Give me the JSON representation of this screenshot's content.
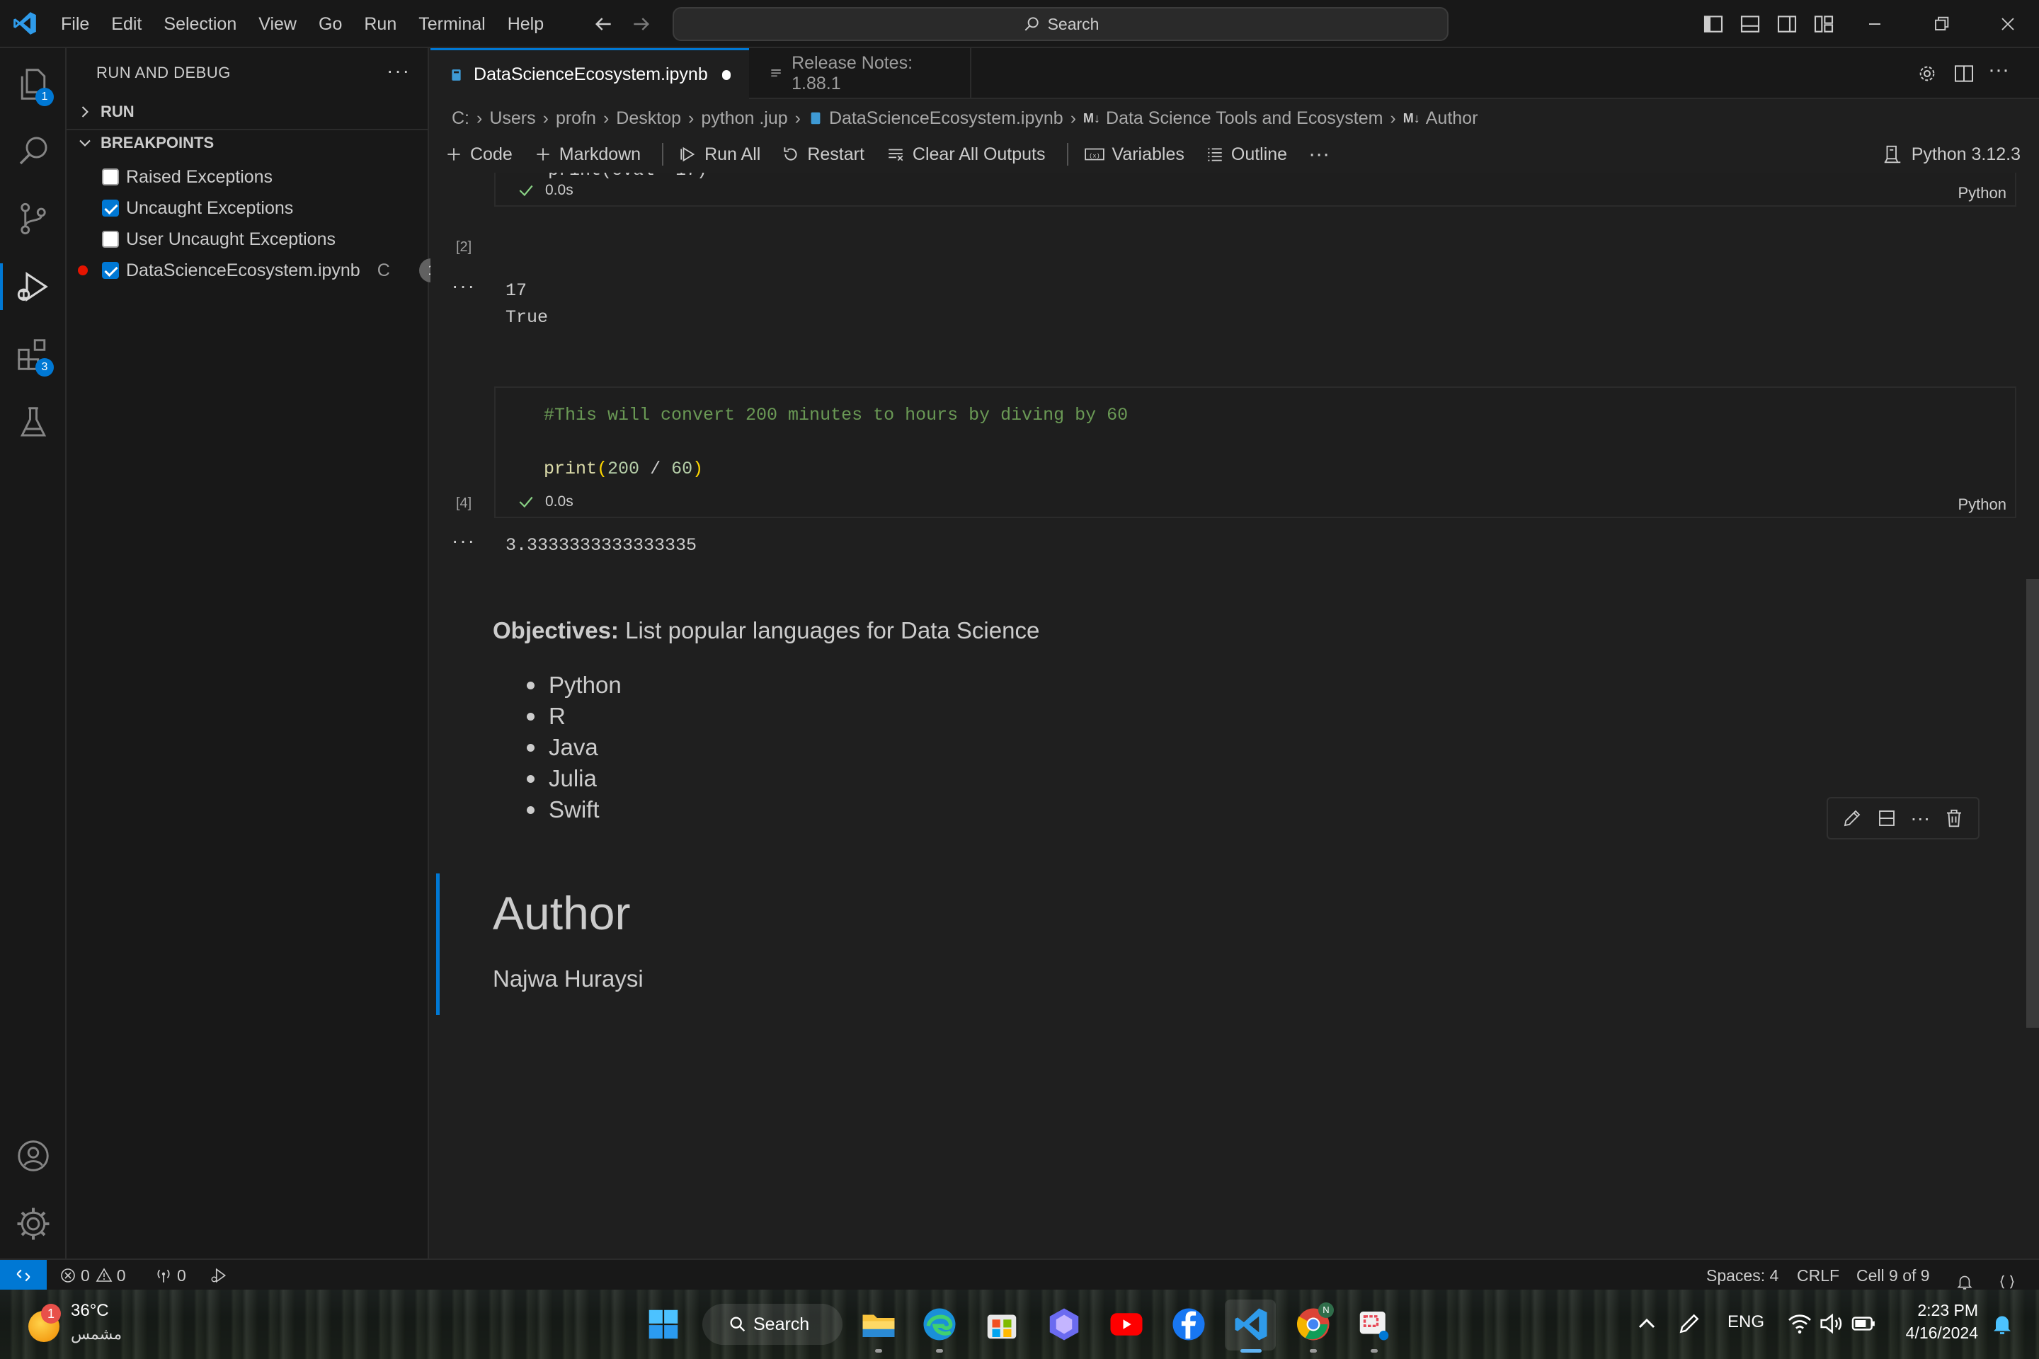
{
  "menubar": [
    "File",
    "Edit",
    "Selection",
    "View",
    "Go",
    "Run",
    "Terminal",
    "Help"
  ],
  "command_center": {
    "label": "Search"
  },
  "activity_badges": {
    "explorer": "1",
    "extensions": "3"
  },
  "sidebar": {
    "title": "RUN AND DEBUG",
    "run_section": "RUN",
    "breakpoints_section": "BREAKPOINTS",
    "breakpoints": [
      {
        "label": "Raised Exceptions",
        "checked": false
      },
      {
        "label": "Uncaught Exceptions",
        "checked": true
      },
      {
        "label": "User Uncaught Exceptions",
        "checked": false
      },
      {
        "label": "DataScienceEcosystem.ipynb",
        "checked": true,
        "suffix": "C",
        "count": "1"
      }
    ]
  },
  "tabs": [
    {
      "label": "DataScienceEcosystem.ipynb",
      "active": true,
      "dirty": true
    },
    {
      "label": "Release Notes: 1.88.1",
      "active": false
    }
  ],
  "breadcrumb": [
    "C:",
    "Users",
    "profn",
    "Desktop",
    "python .jup",
    "DataScienceEcosystem.ipynb",
    "Data Science Tools and Ecosystem",
    "Author"
  ],
  "breadcrumb_md_prefix": "M↓",
  "toolbar": {
    "code": "Code",
    "markdown": "Markdown",
    "run_all": "Run All",
    "restart": "Restart",
    "clear": "Clear All Outputs",
    "variables": "Variables",
    "outline": "Outline"
  },
  "kernel": "Python 3.12.3",
  "cells": [
    {
      "exec": "[2]",
      "partial_code": "print(eval==17)",
      "status": "0.0s",
      "lang": "Python",
      "output": "17\nTrue"
    },
    {
      "exec": "[4]",
      "comment": "#This will convert 200 minutes to hours by diving by 60",
      "code_fn": "print",
      "code_num1": "200",
      "code_op": "/",
      "code_num2": "60",
      "status": "0.0s",
      "lang": "Python",
      "output": "3.3333333333333335"
    }
  ],
  "markdown": {
    "objectives_label": "Objectives:",
    "objectives_text": " List popular languages for Data Science",
    "languages": [
      "Python",
      "R",
      "Java",
      "Julia",
      "Swift"
    ],
    "author_heading": "Author",
    "author_name": "Najwa Huraysi"
  },
  "statusbar": {
    "errors": "0",
    "warnings": "0",
    "ports": "0",
    "spaces": "Spaces: 4",
    "eol": "CRLF",
    "cell": "Cell 9 of 9"
  },
  "taskbar": {
    "weather_temp": "36°C",
    "weather_text": "مشمس",
    "weather_badge": "1",
    "search": "Search",
    "lang": "ENG",
    "time": "2:23 PM",
    "date": "4/16/2024"
  },
  "colors": {
    "accent": "#0078d4",
    "background": "#1f1f1f",
    "sidebar": "#181818",
    "breakpoint": "#e51400"
  }
}
